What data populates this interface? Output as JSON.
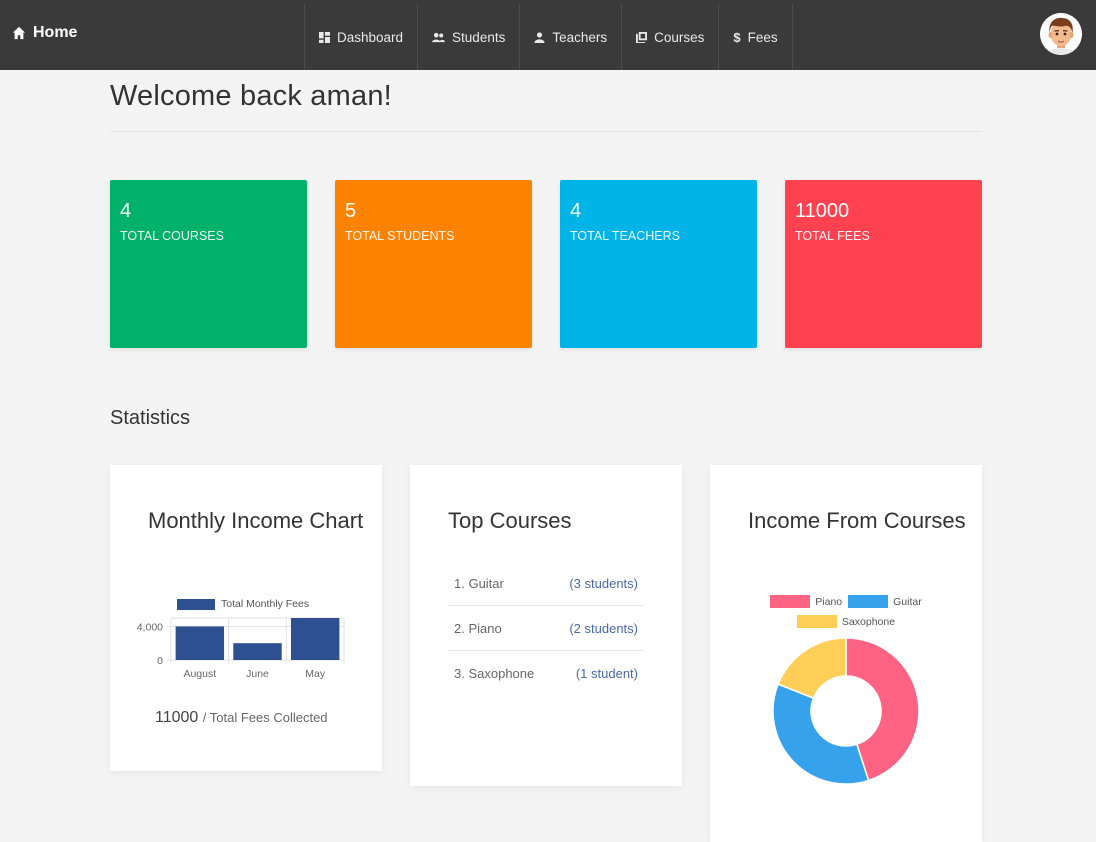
{
  "nav": {
    "brand": "Home",
    "items": [
      {
        "label": "Dashboard",
        "icon": "dashboard-icon"
      },
      {
        "label": "Students",
        "icon": "users-icon"
      },
      {
        "label": "Teachers",
        "icon": "user-icon"
      },
      {
        "label": "Courses",
        "icon": "books-icon"
      },
      {
        "label": "Fees",
        "icon": "dollar-icon"
      }
    ]
  },
  "welcome": "Welcome back aman!",
  "stats": [
    {
      "value": "4",
      "label": "TOTAL COURSES",
      "color": "#00b16a"
    },
    {
      "value": "5",
      "label": "TOTAL STUDENTS",
      "color": "#ff8303"
    },
    {
      "value": "4",
      "label": "TOTAL TEACHERS",
      "color": "#00b4e8"
    },
    {
      "value": "11000",
      "label": "TOTAL FEES",
      "color": "#ff4150"
    }
  ],
  "statistics_title": "Statistics",
  "monthly": {
    "title": "Monthly Income Chart",
    "total": "11000",
    "total_label": "/ Total Fees Collected"
  },
  "top_courses": {
    "title": "Top Courses",
    "items": [
      {
        "name": "1. Guitar",
        "count": "(3 students)"
      },
      {
        "name": "2. Piano",
        "count": "(2 students)"
      },
      {
        "name": "3. Saxophone",
        "count": "(1 student)"
      }
    ]
  },
  "income_courses": {
    "title": "Income From Courses"
  },
  "chart_data": [
    {
      "type": "bar",
      "categories": [
        "August",
        "June",
        "May"
      ],
      "series": [
        {
          "name": "Total Monthly Fees",
          "values": [
            4000,
            2000,
            5000
          ],
          "color": "#2f5090"
        }
      ],
      "yticks": [
        0,
        4000
      ],
      "ytick_labels": [
        "0",
        "4,000"
      ],
      "ylim": [
        0,
        5000
      ],
      "grid": true,
      "legend": "top"
    },
    {
      "type": "pie",
      "donut": true,
      "categories": [
        "Piano",
        "Guitar",
        "Saxophone"
      ],
      "values": [
        45,
        36,
        19
      ],
      "colors": [
        "#ff6384",
        "#36a2eb",
        "#ffce56"
      ],
      "legend": "top"
    }
  ]
}
